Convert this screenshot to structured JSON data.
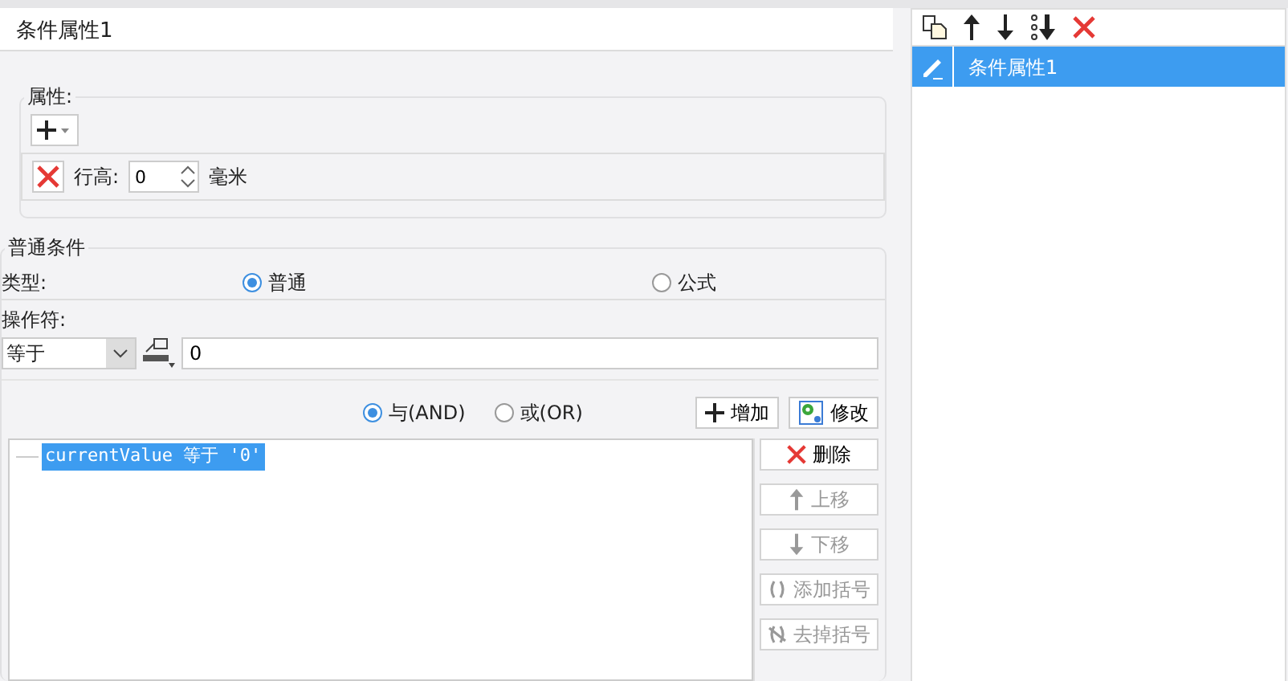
{
  "title": "条件属性1",
  "properties": {
    "legend": "属性:",
    "row_height_label": "行高:",
    "row_height_value": "0",
    "row_height_unit": "毫米"
  },
  "condition": {
    "legend": "普通条件",
    "type_label": "类型:",
    "types": [
      {
        "label": "普通",
        "selected": true
      },
      {
        "label": "公式",
        "selected": false
      }
    ],
    "operator_label": "操作符:",
    "operator": "等于",
    "value": "0",
    "logic": [
      {
        "label": "与(AND)",
        "selected": true
      },
      {
        "label": "或(OR)",
        "selected": false
      }
    ],
    "add_button": "增加",
    "modify_button": "修改",
    "conditions": [
      {
        "text": "currentValue 等于 '0'",
        "selected": true
      }
    ],
    "side_buttons": [
      {
        "kind": "delete",
        "label": "删除",
        "disabled": false
      },
      {
        "kind": "up",
        "label": "上移",
        "disabled": true
      },
      {
        "kind": "down",
        "label": "下移",
        "disabled": true
      },
      {
        "kind": "add-bracket",
        "label": "添加括号",
        "disabled": true
      },
      {
        "kind": "remove-bracket",
        "label": "去掉括号",
        "disabled": true
      }
    ]
  },
  "list": [
    {
      "label": "条件属性1",
      "selected": true
    }
  ]
}
